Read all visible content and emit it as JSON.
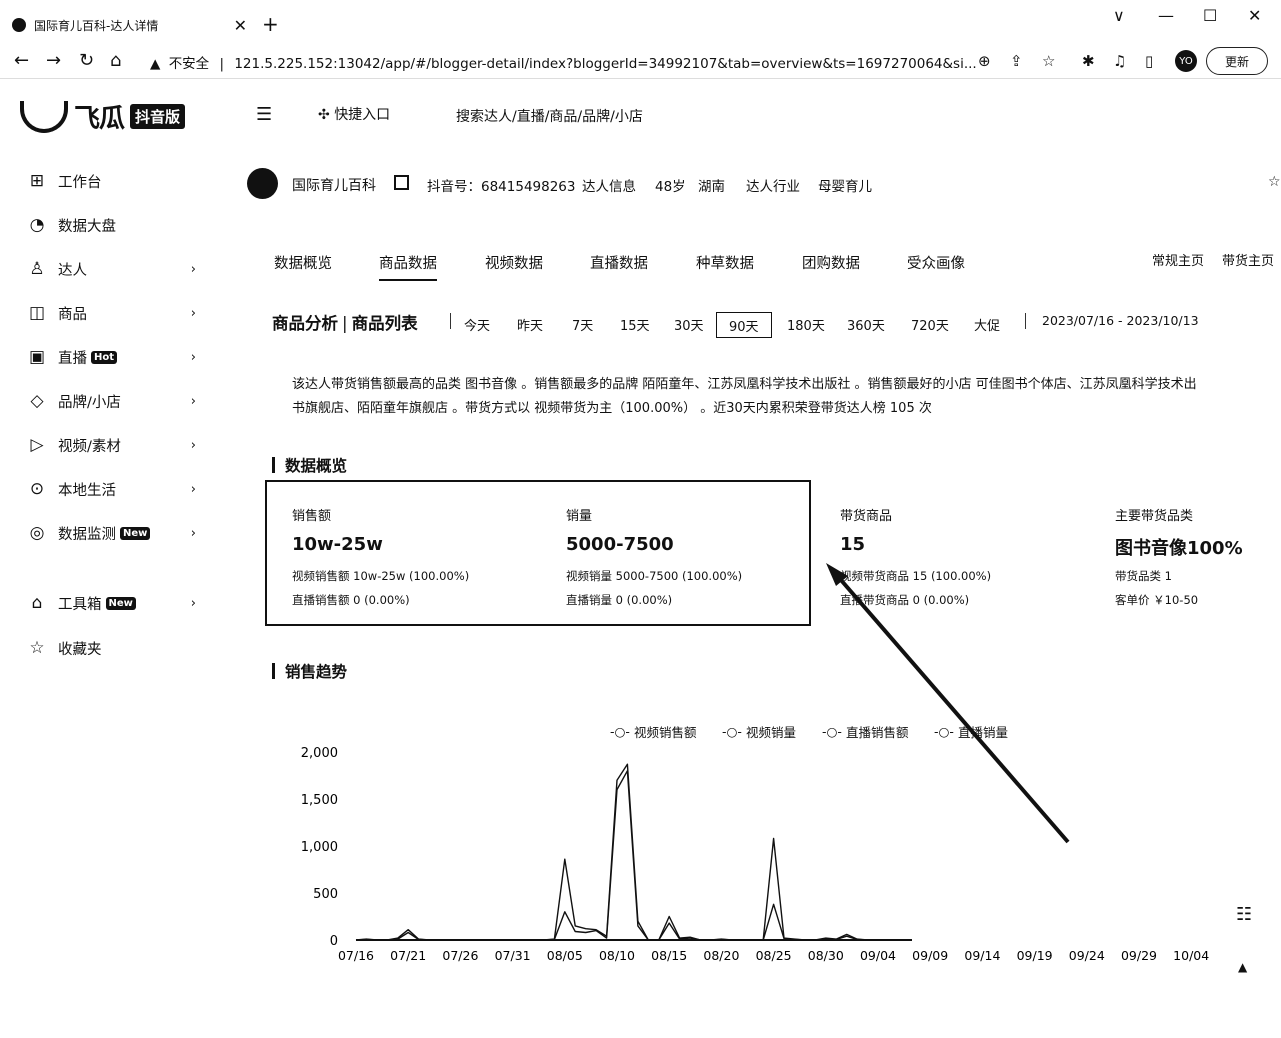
{
  "browser": {
    "tab_title": "国际育儿百科-达人详情",
    "new_tab": "+",
    "window_controls": [
      "∨",
      "—",
      "☐",
      "✕"
    ],
    "security_label": "不安全",
    "url": "121.5.225.152:13042/app/#/blogger-detail/index?bloggerId=34992107&tab=overview&ts=1697270064&si...",
    "avatar_text": "YO",
    "update_label": "更新"
  },
  "header": {
    "logo_text": "飞瓜",
    "edition": "抖音版",
    "quick_entry": "快捷入口",
    "search_placeholder": "搜索达人/直播/商品/品牌/小店"
  },
  "sidebar": {
    "items": [
      {
        "label": "工作台",
        "icon": "grid-icon",
        "glyph": "⊞",
        "chevron": false
      },
      {
        "label": "数据大盘",
        "icon": "pie-chart-icon",
        "glyph": "◔",
        "chevron": false
      },
      {
        "label": "达人",
        "icon": "user-icon",
        "glyph": "♙",
        "chevron": true
      },
      {
        "label": "商品",
        "icon": "shopping-bag-icon",
        "glyph": "◫",
        "chevron": true
      },
      {
        "label": "直播",
        "icon": "monitor-icon",
        "glyph": "▣",
        "chevron": true,
        "badge": "Hot"
      },
      {
        "label": "品牌/小店",
        "icon": "tag-icon",
        "glyph": "◇",
        "chevron": true
      },
      {
        "label": "视频/素材",
        "icon": "play-icon",
        "glyph": "▷",
        "chevron": true
      },
      {
        "label": "本地生活",
        "icon": "location-icon",
        "glyph": "⊙",
        "chevron": true
      },
      {
        "label": "数据监测",
        "icon": "monitor-pulse-icon",
        "glyph": "◎",
        "chevron": true,
        "badge": "New"
      },
      {
        "label": "工具箱",
        "icon": "toolbox-icon",
        "glyph": "⌂",
        "chevron": true,
        "badge": "New"
      },
      {
        "label": "收藏夹",
        "icon": "star-icon",
        "glyph": "☆",
        "chevron": false
      }
    ]
  },
  "profile": {
    "name": "国际育儿百科",
    "douyin_id": "抖音号：68415498263",
    "info_label": "达人信息",
    "age": "48岁",
    "region": "湖南",
    "industry_label": "达人行业",
    "industry": "母婴育儿"
  },
  "tabs": [
    "数据概览",
    "商品数据",
    "视频数据",
    "直播数据",
    "种草数据",
    "团购数据",
    "受众画像"
  ],
  "active_tab": "商品数据",
  "home_links": [
    "常规主页",
    "带货主页"
  ],
  "filter": {
    "view_a": "商品分析",
    "view_b": "商品列表",
    "ranges": [
      "今天",
      "昨天",
      "7天",
      "15天",
      "30天",
      "90天",
      "180天",
      "360天",
      "720天",
      "大促"
    ],
    "selected_range": "90天",
    "date_range": "2023/07/16  - 2023/10/13"
  },
  "summary": {
    "line1": "该达人带货销售额最高的品类 图书音像 。销售额最多的品牌 陌陌童年、江苏凤凰科学技术出版社 。销售额最好的小店 可佳图书个体店、江苏凤凰科学技术出",
    "line2": "书旗舰店、陌陌童年旗舰店 。带货方式以 视频带货为主（100.00%） 。近30天内累积荣登带货达人榜 105 次"
  },
  "overview": {
    "title": "数据概览",
    "kpis": [
      {
        "label": "销售额",
        "value": "10w-25w",
        "sub1": "视频销售额 10w-25w (100.00%)",
        "sub2": "直播销售额 0 (0.00%)"
      },
      {
        "label": "销量",
        "value": "5000-7500",
        "sub1": "视频销量 5000-7500 (100.00%)",
        "sub2": "直播销量 0 (0.00%)"
      },
      {
        "label": "带货商品",
        "value": "15",
        "sub1": "视频带货商品 15 (100.00%)",
        "sub2": "直播带货商品 0 (0.00%)"
      },
      {
        "label": "主要带货品类",
        "value": "图书音像100%",
        "sub1": "带货品类 1",
        "sub2": "客单价 ￥10-50"
      }
    ]
  },
  "trend": {
    "title": "销售趋势"
  },
  "colors": {
    "ink": "#111111",
    "background": "#ffffff"
  },
  "chart_data": {
    "type": "line",
    "ylim": [
      0,
      2000
    ],
    "yticks": [
      "2,000",
      "1,500",
      "1,000",
      "500",
      "0"
    ],
    "xticks": [
      "07/16",
      "07/21",
      "07/26",
      "07/31",
      "08/05",
      "08/10",
      "08/15",
      "08/20",
      "08/25",
      "08/30",
      "09/04",
      "09/09",
      "09/14",
      "09/19",
      "09/24",
      "09/29",
      "10/04"
    ],
    "x": [
      "07/16",
      "07/17",
      "07/18",
      "07/19",
      "07/20",
      "07/21",
      "07/22",
      "07/23",
      "07/24",
      "07/25",
      "07/26",
      "07/27",
      "07/28",
      "07/29",
      "07/30",
      "07/31",
      "08/01",
      "08/02",
      "08/03",
      "08/04",
      "08/05",
      "08/06",
      "08/07",
      "08/08",
      "08/09",
      "08/10",
      "08/11",
      "08/12",
      "08/13",
      "08/14",
      "08/15",
      "08/16",
      "08/17",
      "08/18",
      "08/19",
      "08/20",
      "08/21",
      "08/22",
      "08/23",
      "08/24",
      "08/25",
      "08/26",
      "08/27",
      "08/28",
      "08/29",
      "08/30",
      "08/31",
      "09/01",
      "09/02",
      "09/03",
      "09/04",
      "09/05",
      "09/06",
      "09/07"
    ],
    "series": [
      {
        "name": "视频销售额",
        "values": [
          0,
          10,
          0,
          0,
          20,
          110,
          10,
          0,
          0,
          0,
          0,
          0,
          0,
          0,
          0,
          0,
          0,
          0,
          0,
          10,
          860,
          150,
          120,
          110,
          40,
          1700,
          1870,
          200,
          0,
          0,
          250,
          20,
          30,
          0,
          0,
          10,
          0,
          0,
          0,
          0,
          1080,
          20,
          10,
          0,
          0,
          20,
          10,
          60,
          10,
          0,
          0,
          0,
          0,
          0
        ]
      },
      {
        "name": "视频销量",
        "values": [
          0,
          5,
          0,
          0,
          10,
          80,
          5,
          0,
          0,
          0,
          0,
          0,
          0,
          0,
          0,
          0,
          0,
          0,
          0,
          5,
          300,
          90,
          80,
          100,
          20,
          1600,
          1800,
          150,
          0,
          0,
          180,
          10,
          20,
          0,
          0,
          5,
          0,
          0,
          0,
          0,
          380,
          15,
          5,
          0,
          0,
          10,
          5,
          40,
          5,
          0,
          0,
          0,
          0,
          0
        ]
      },
      {
        "name": "直播销售额",
        "values": [
          0,
          0,
          0,
          0,
          0,
          0,
          0,
          0,
          0,
          0,
          0,
          0,
          0,
          0,
          0,
          0,
          0,
          0,
          0,
          0,
          0,
          0,
          0,
          0,
          0,
          0,
          0,
          0,
          0,
          0,
          0,
          0,
          0,
          0,
          0,
          0,
          0,
          0,
          0,
          0,
          0,
          0,
          0,
          0,
          0,
          0,
          0,
          0,
          0,
          0,
          0,
          0,
          0,
          0
        ]
      },
      {
        "name": "直播销量",
        "values": [
          0,
          0,
          0,
          0,
          0,
          0,
          0,
          0,
          0,
          0,
          0,
          0,
          0,
          0,
          0,
          0,
          0,
          0,
          0,
          0,
          0,
          0,
          0,
          0,
          0,
          0,
          0,
          0,
          0,
          0,
          0,
          0,
          0,
          0,
          0,
          0,
          0,
          0,
          0,
          0,
          0,
          0,
          0,
          0,
          0,
          0,
          0,
          0,
          0,
          0,
          0,
          0,
          0,
          0
        ]
      }
    ]
  }
}
